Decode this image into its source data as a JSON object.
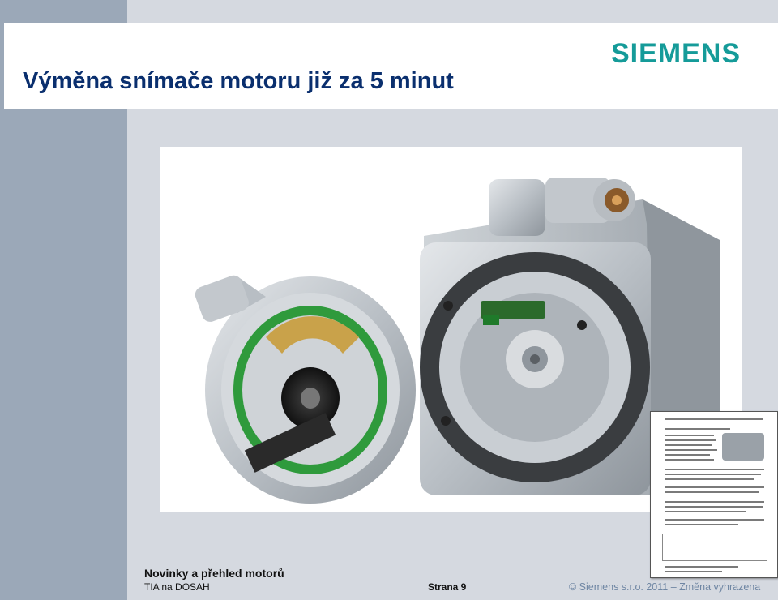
{
  "slide": {
    "title": "Výměna snímače motoru již za 5 minut",
    "logo": "SIEMENS"
  },
  "colors": {
    "brand_petrol": "#159b99",
    "title_blue": "#0a2f6e",
    "side_band": "#9ba8b8",
    "background": "#d5d9e0",
    "copyright_blue": "#6f86a3"
  },
  "images": {
    "main_photo": "encoder-and-servo-motor-photo",
    "document_thumbnail": "service-instruction-document"
  },
  "footer": {
    "subtitle": "Novinky a přehled motorů",
    "left": "TIA na DOSAH",
    "page": "Strana 9",
    "copyright": "© Siemens s.r.o. 2011 – Změna vyhrazena"
  }
}
